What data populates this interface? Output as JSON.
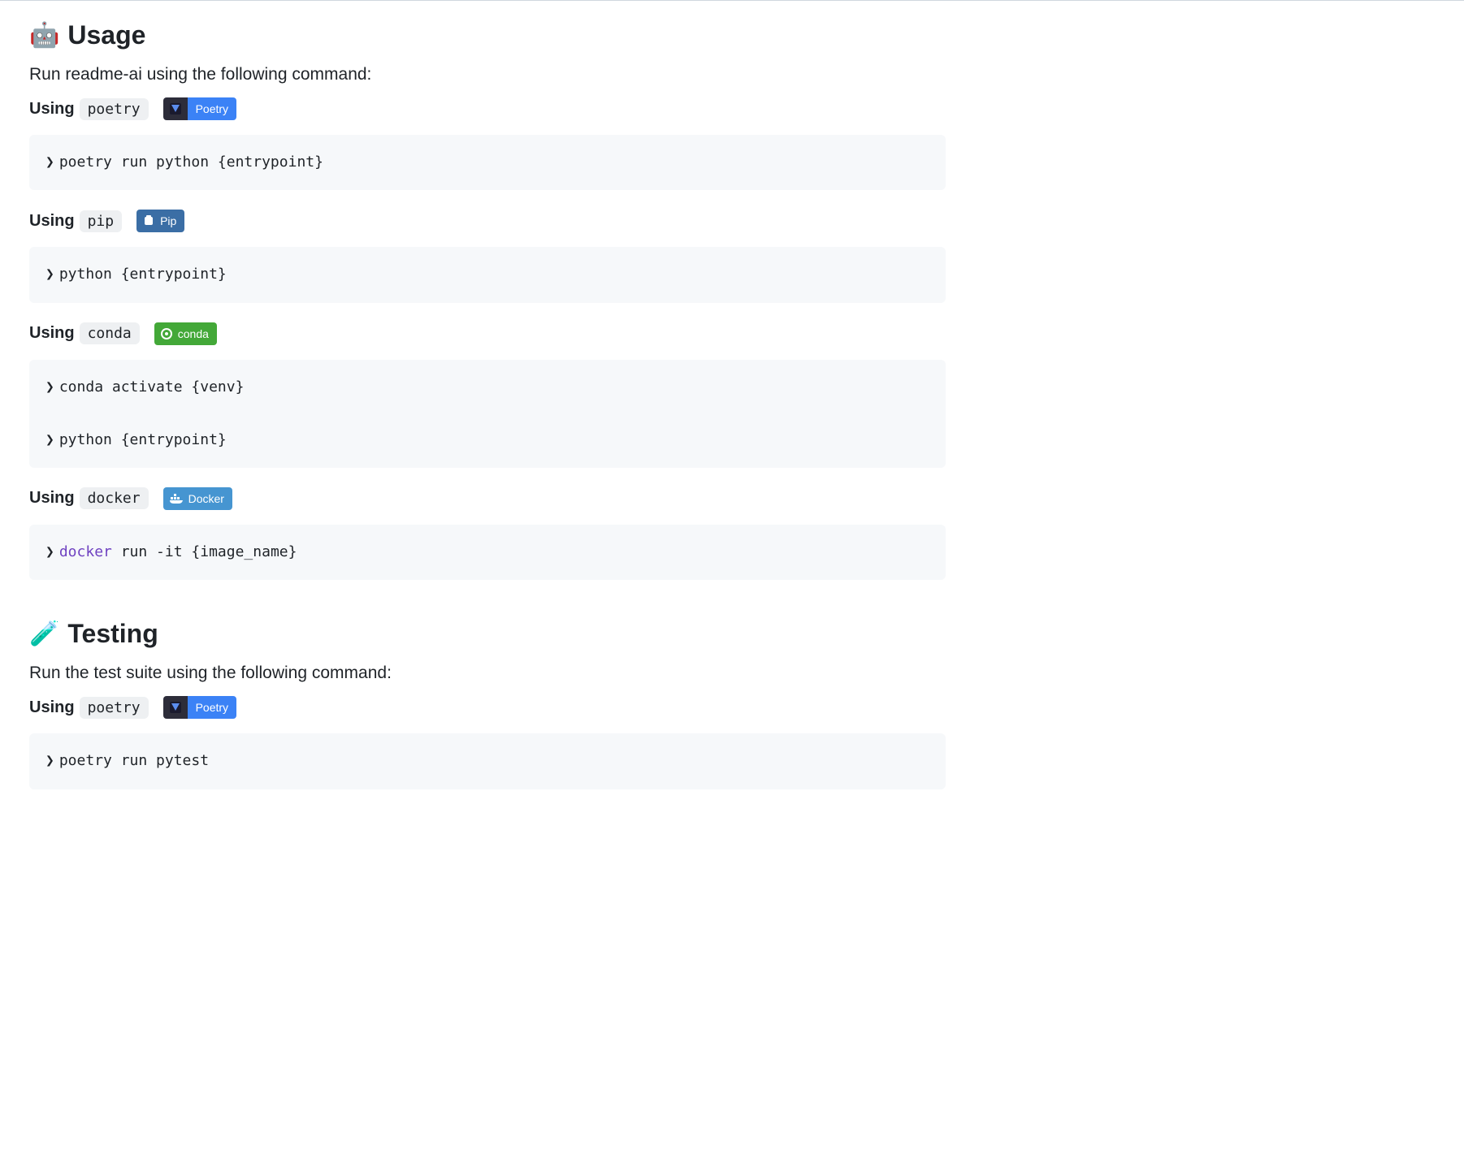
{
  "usage": {
    "heading": "Usage",
    "icon": "🤖",
    "intro": "Run readme-ai using the following command:",
    "using_prefix": "Using",
    "tools": [
      {
        "name": "poetry",
        "badge_label": "Poetry",
        "badge_style": "poetry",
        "code_lines": [
          {
            "prompt": "❯",
            "text": "poetry run python {entrypoint}"
          }
        ]
      },
      {
        "name": "pip",
        "badge_label": "Pip",
        "badge_style": "pip",
        "code_lines": [
          {
            "prompt": "❯",
            "text": "python {entrypoint}"
          }
        ]
      },
      {
        "name": "conda",
        "badge_label": "conda",
        "badge_style": "conda",
        "code_lines": [
          {
            "prompt": "❯",
            "text": "conda activate {venv}"
          },
          {
            "prompt": "❯",
            "text": "python {entrypoint}"
          }
        ]
      },
      {
        "name": "docker",
        "badge_label": "Docker",
        "badge_style": "docker",
        "code_lines": [
          {
            "prompt": "❯",
            "keyword": "docker",
            "text": " run -it {image_name}"
          }
        ]
      }
    ]
  },
  "testing": {
    "heading": "Testing",
    "icon": "🧪",
    "intro": "Run the test suite using the following command:",
    "using_prefix": "Using",
    "tools": [
      {
        "name": "poetry",
        "badge_label": "Poetry",
        "badge_style": "poetry",
        "code_lines": [
          {
            "prompt": "❯",
            "text": "poetry run pytest"
          }
        ]
      }
    ]
  }
}
